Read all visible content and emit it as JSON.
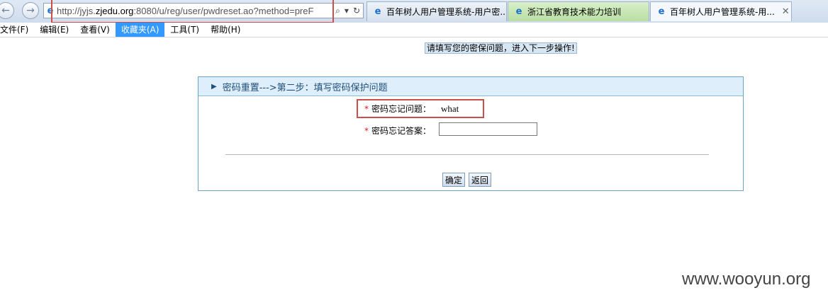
{
  "browser": {
    "url_host": "http://jyjs.",
    "url_domain": "zjedu.org",
    "url_rest": ":8080/u/reg/user/pwdreset.ao?method=preF",
    "search_glyph": "⌕",
    "dropdown_glyph": "▾",
    "refresh_glyph": "↻",
    "tabs": [
      {
        "label": "百年树人用户管理系统-用户密..."
      },
      {
        "label": "浙江省教育技术能力培训"
      },
      {
        "label": "百年树人用户管理系统-用..."
      }
    ],
    "close_glyph": "✕",
    "back_glyph": "←",
    "forward_glyph": "→",
    "ie_glyph": "e"
  },
  "menubar": {
    "items": [
      "文件(F)",
      "编辑(E)",
      "查看(V)",
      "收藏夹(A)",
      "工具(T)",
      "帮助(H)"
    ]
  },
  "page": {
    "hint": "请填写您的密保问题，进入下一步操作!",
    "panel_title": "密码重置--->第二步：填写密码保护问题",
    "triangle_glyph": "▶",
    "question_label": "密码忘记问题：",
    "question_value": "what",
    "answer_label": "密码忘记答案：",
    "answer_value": "",
    "required_mark": "*",
    "confirm_label": "确定",
    "back_label": "返回"
  },
  "watermark": "www.wooyun.org",
  "colors": {
    "annotation_red": "#c9504a",
    "panel_border": "#6aa5c8",
    "panel_header": "#deeefa",
    "menu_highlight": "#3399ff"
  }
}
